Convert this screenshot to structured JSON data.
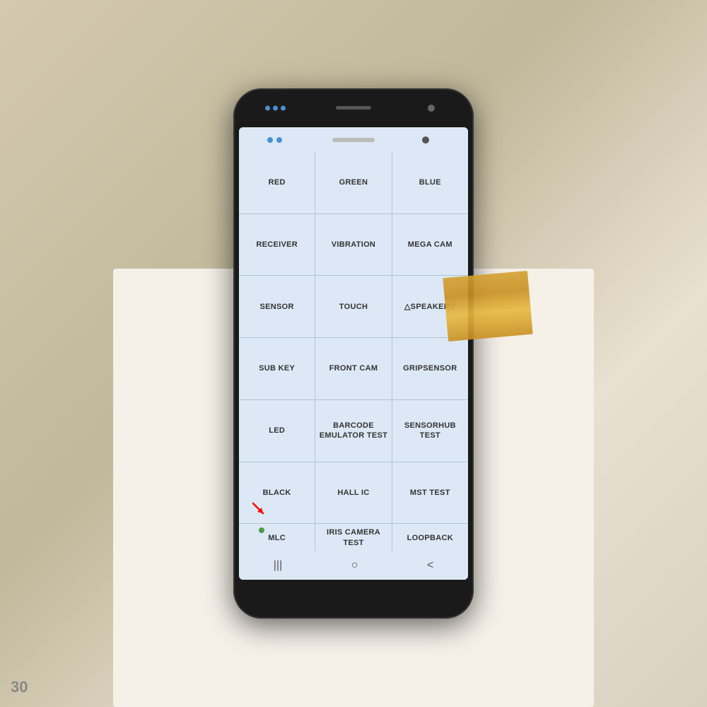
{
  "phone": {
    "grid": [
      [
        {
          "id": "red",
          "label": "RED"
        },
        {
          "id": "green",
          "label": "GREEN"
        },
        {
          "id": "blue",
          "label": "BLUE"
        }
      ],
      [
        {
          "id": "receiver",
          "label": "RECEIVER"
        },
        {
          "id": "vibration",
          "label": "VIBRATION"
        },
        {
          "id": "mega-cam",
          "label": "MEGA CAM"
        }
      ],
      [
        {
          "id": "sensor",
          "label": "SENSOR"
        },
        {
          "id": "touch",
          "label": "TOUCH"
        },
        {
          "id": "speaker",
          "label": "△SPEAKER▽"
        }
      ],
      [
        {
          "id": "sub-key",
          "label": "SUB KEY"
        },
        {
          "id": "front-cam",
          "label": "FRONT CAM"
        },
        {
          "id": "gripsensor",
          "label": "GRIPSENSOR"
        }
      ],
      [
        {
          "id": "led",
          "label": "LED"
        },
        {
          "id": "barcode-emulator",
          "label": "BARCODE\nEMULATOR TEST"
        },
        {
          "id": "sensorhub-test",
          "label": "SENSORHUB TEST"
        }
      ],
      [
        {
          "id": "black",
          "label": "BLACK"
        },
        {
          "id": "hall-ic",
          "label": "HALL IC"
        },
        {
          "id": "mst-test",
          "label": "MST TEST"
        }
      ],
      [
        {
          "id": "mlc",
          "label": "MLC"
        },
        {
          "id": "iris-camera",
          "label": "IRIS CAMERA\nTEST"
        },
        {
          "id": "loopback",
          "label": "LOOPBACK"
        }
      ]
    ],
    "nav": {
      "recent": "|||",
      "home": "○",
      "back": "<"
    }
  },
  "page_number": "30"
}
